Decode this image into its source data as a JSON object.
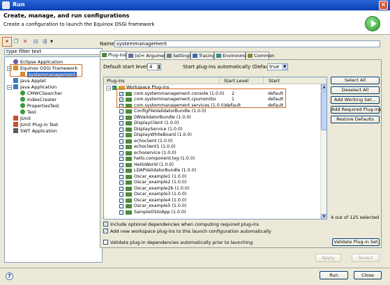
{
  "window": {
    "title": "Run",
    "close_glyph": "×"
  },
  "header": {
    "title": "Create, manage, and run configurations",
    "description": "Create a configuration to launch the Equinox OSGi framework",
    "logo_icon": "run-icon"
  },
  "left": {
    "toolbar_icons": [
      "new-config-icon",
      "duplicate-icon",
      "delete-icon",
      "collapse-all-icon",
      "filter-icon"
    ],
    "filter_text": "type filter text",
    "tree": [
      {
        "label": "Eclipse Application",
        "level": 1,
        "icon": "eclipse-icon"
      },
      {
        "label": "Equinox OSGi Framework",
        "level": 1,
        "icon": "osgi-icon",
        "expanded": true
      },
      {
        "label": "systemmanagement",
        "level": 2,
        "icon": "osgi-config-icon",
        "selected": true
      },
      {
        "label": "Java Applet",
        "level": 1,
        "icon": "applet-icon"
      },
      {
        "label": "Java Application",
        "level": 1,
        "icon": "java-app-icon",
        "expanded": true
      },
      {
        "label": "CMWCSearcher",
        "level": 2,
        "icon": "java-class-icon"
      },
      {
        "label": "IndexCreater",
        "level": 2,
        "icon": "java-class-icon"
      },
      {
        "label": "PropertiesTest",
        "level": 2,
        "icon": "java-class-icon"
      },
      {
        "label": "Test",
        "level": 2,
        "icon": "java-class-icon"
      },
      {
        "label": "JUnit",
        "level": 1,
        "icon": "junit-icon"
      },
      {
        "label": "JUnit Plug-in Test",
        "level": 1,
        "icon": "junit-plugin-icon"
      },
      {
        "label": "SWT Application",
        "level": 1,
        "icon": "swt-icon"
      }
    ]
  },
  "right": {
    "name_label": "Name:",
    "name_value": "systemmanagement",
    "tabs": [
      {
        "label": "Plug-ins",
        "active": true,
        "icon": "plugin-icon"
      },
      {
        "label": "(x)= Arguments",
        "icon": "arguments-icon"
      },
      {
        "label": "Settings",
        "icon": "settings-icon"
      },
      {
        "label": "Tracing",
        "icon": "tracing-icon"
      },
      {
        "label": "Environment",
        "icon": "environment-icon"
      },
      {
        "label": "Common",
        "icon": "common-icon"
      }
    ],
    "default_start_level_label": "Default start level:",
    "default_start_level_value": "4",
    "auto_start_label": "Start plug-ins automatically (Default):",
    "auto_start_value": "true",
    "table": {
      "columns": [
        "Plug-ins",
        "Start Level",
        "Start"
      ],
      "group_label": "Workspace Plug-ins",
      "rows": [
        {
          "name": "com.systemmanagement.console (1.0.0)",
          "checked": true,
          "level": "2",
          "start": "default"
        },
        {
          "name": "com.systemmanagement.cpumonitor (1.0.0)",
          "checked": true,
          "level": "1",
          "start": "default"
        },
        {
          "name": "com.systemmanagement.services (1.0.0)",
          "checked": true,
          "level": "default",
          "start": "default"
        },
        {
          "name": "ConfigFileValidatorBundle (1.0.0)",
          "checked": false
        },
        {
          "name": "DBValidatorBundle (1.0.0)",
          "checked": false
        },
        {
          "name": "DisplayClient (1.0.0)",
          "checked": false
        },
        {
          "name": "DisplayService (1.0.0)",
          "checked": false
        },
        {
          "name": "DisplayWhiteBoard (1.0.0)",
          "checked": false
        },
        {
          "name": "echoclient (1.0.0)",
          "checked": false
        },
        {
          "name": "echoclient1 (1.0.0)",
          "checked": false
        },
        {
          "name": "echoservice (1.0.0)",
          "checked": false
        },
        {
          "name": "hello.component.log (1.0.0)",
          "checked": false
        },
        {
          "name": "HelloWorld (1.0.0)",
          "checked": false
        },
        {
          "name": "LDAPValidatorBundle (1.0.0)",
          "checked": false
        },
        {
          "name": "Oscar_example1 (1.0.0)",
          "checked": false
        },
        {
          "name": "Oscar_example2 (1.0.0)",
          "checked": false
        },
        {
          "name": "Oscar_example2b (1.0.0)",
          "checked": false
        },
        {
          "name": "Oscar_example3 (1.0.0)",
          "checked": false
        },
        {
          "name": "Oscar_example4 (1.0.0)",
          "checked": false
        },
        {
          "name": "Oscar_example5 (1.0.0)",
          "checked": false
        },
        {
          "name": "SampleOSGiApp (1.0.0)",
          "checked": false
        }
      ]
    },
    "side_buttons": [
      "Select All",
      "Deselect All",
      "Add Working Set...",
      "Add Required Plug-ins",
      "Restore Defaults"
    ],
    "count_text": "4 out of 125 selected",
    "options": [
      {
        "label": "Include optional dependencies when computing required plug-ins",
        "checked": true
      },
      {
        "label": "Add new workspace plug-ins to this launch configuration automatically",
        "checked": true
      }
    ],
    "validate_label": "Validate plug-in dependencies automatically prior to launching",
    "validate_checked": false,
    "validate_button": "Validate Plug-in Set",
    "apply_button": "Apply",
    "revert_button": "Revert"
  },
  "footer": {
    "help_icon": "help-icon",
    "help_glyph": "?",
    "run_button": "Run",
    "close_button": "Close"
  },
  "colors": {
    "title_bar": "#0a3fb4",
    "selection": "#316ac5",
    "annotation": "#d26a1e",
    "check": "#21a121"
  }
}
